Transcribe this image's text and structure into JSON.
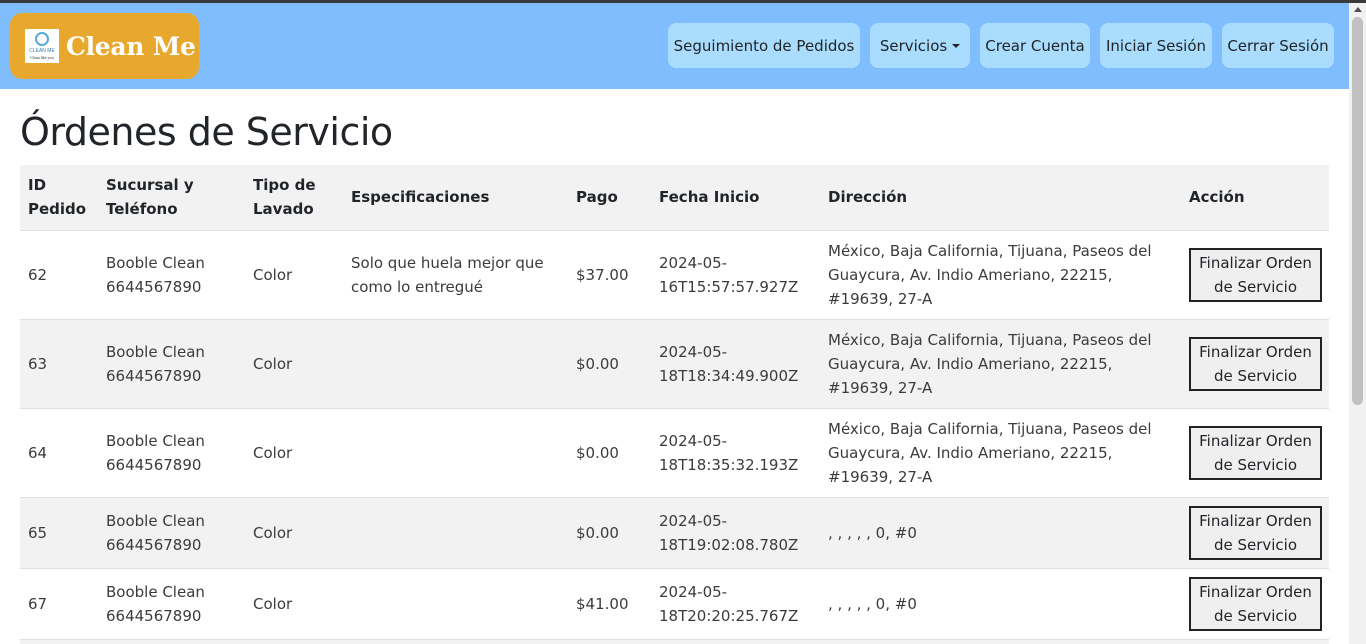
{
  "navbar": {
    "brand_name": "Clean Me",
    "logo_text": "CLEAN ME",
    "logo_subtext": "Clean like you",
    "items": [
      {
        "label": "Seguimiento de Pedidos"
      },
      {
        "label": "Servicios"
      },
      {
        "label": "Crear Cuenta"
      },
      {
        "label": "Iniciar Sesión"
      },
      {
        "label": "Cerrar Sesión"
      }
    ]
  },
  "page": {
    "title": "Órdenes de Servicio"
  },
  "table": {
    "headers": {
      "id_a": "ID",
      "id_b": "Pedido",
      "sucursal_a": "Sucursal y",
      "sucursal_b": "Teléfono",
      "tipo_a": "Tipo de",
      "tipo_b": "Lavado",
      "especificaciones": "Especificaciones",
      "pago": "Pago",
      "fecha": "Fecha Inicio",
      "direccion": "Dirección",
      "accion": "Acción"
    },
    "rows": [
      {
        "id": "62",
        "sucursal": "Booble Clean",
        "telefono": "6644567890",
        "tipo": "Color",
        "especificaciones": "Solo que huela mejor que como lo entregué",
        "pago": "$37.00",
        "fecha_a": "2024-05-",
        "fecha_b": "16T15:57:57.927Z",
        "direccion": "México, Baja California, Tijuana, Paseos del Guaycura, Av. Indio Ameriano, 22215, #19639, 27-A",
        "accion_a": "Finalizar Orden",
        "accion_b": "de Servicio"
      },
      {
        "id": "63",
        "sucursal": "Booble Clean",
        "telefono": "6644567890",
        "tipo": "Color",
        "especificaciones": "",
        "pago": "$0.00",
        "fecha_a": "2024-05-",
        "fecha_b": "18T18:34:49.900Z",
        "direccion": "México, Baja California, Tijuana, Paseos del Guaycura, Av. Indio Ameriano, 22215, #19639, 27-A",
        "accion_a": "Finalizar Orden",
        "accion_b": "de Servicio"
      },
      {
        "id": "64",
        "sucursal": "Booble Clean",
        "telefono": "6644567890",
        "tipo": "Color",
        "especificaciones": "",
        "pago": "$0.00",
        "fecha_a": "2024-05-",
        "fecha_b": "18T18:35:32.193Z",
        "direccion": "México, Baja California, Tijuana, Paseos del Guaycura, Av. Indio Ameriano, 22215, #19639, 27-A",
        "accion_a": "Finalizar Orden",
        "accion_b": "de Servicio"
      },
      {
        "id": "65",
        "sucursal": "Booble Clean",
        "telefono": "6644567890",
        "tipo": "Color",
        "especificaciones": "",
        "pago": "$0.00",
        "fecha_a": "2024-05-",
        "fecha_b": "18T19:02:08.780Z",
        "direccion": ", , , , , 0, #0",
        "accion_a": "Finalizar Orden",
        "accion_b": "de Servicio"
      },
      {
        "id": "67",
        "sucursal": "Booble Clean",
        "telefono": "6644567890",
        "tipo": "Color",
        "especificaciones": "",
        "pago": "$41.00",
        "fecha_a": "2024-05-",
        "fecha_b": "18T20:20:25.767Z",
        "direccion": ", , , , , 0, #0",
        "accion_a": "Finalizar Orden",
        "accion_b": "de Servicio"
      }
    ]
  },
  "colors": {
    "navbar_bg": "#80bdff",
    "brand_bg": "#e8a82e",
    "nav_button_bg": "#a9dcfd",
    "stripe_bg": "#f2f2f2"
  }
}
